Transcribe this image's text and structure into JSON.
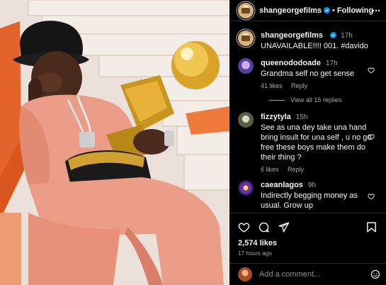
{
  "header": {
    "username": "shangeorgefilms",
    "follow_state": "Following",
    "separator": "•"
  },
  "caption": {
    "username": "shangeorgefilms",
    "text": "UNAVAILABLE!!!! 001. #davido",
    "time": "17h"
  },
  "comments": [
    {
      "username": "queenododoade",
      "time": "17h",
      "text": "Grandma self no get sense",
      "likes": "41 likes",
      "reply": "Reply",
      "view_replies": "View all 15 replies"
    },
    {
      "username": "fizzytyla",
      "time": "15h",
      "text": "See as una dey take una hand bring insult for una self , u no go free these boys make them do their thing ?",
      "likes": "6 likes",
      "reply": "Reply"
    },
    {
      "username": "caeanlagos",
      "time": "9h",
      "text": "Indirectly begging money as usual. Grow up"
    }
  ],
  "actions": {
    "likes": "2,574 likes",
    "posted_ago": "17 hours ago",
    "icons": [
      "heart-icon",
      "comment-icon",
      "share-icon",
      "bookmark-icon"
    ]
  },
  "add_comment": {
    "placeholder": "Add a comment..."
  },
  "colors": {
    "background": "#000000",
    "divider": "#262626",
    "muted": "#a8a8a8",
    "verified": "#0095f6"
  }
}
